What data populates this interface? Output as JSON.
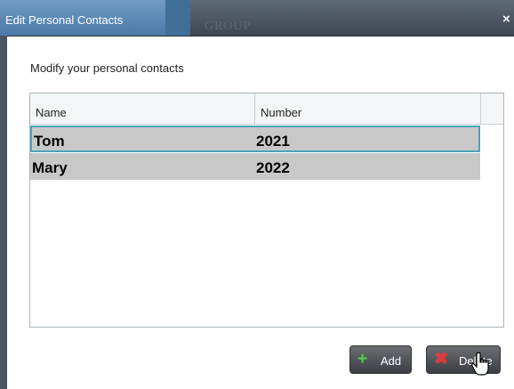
{
  "dialog": {
    "title": "Edit Personal Contacts",
    "background_title": "GROUP",
    "close_label": "×",
    "subtitle": "Modify your personal contacts"
  },
  "table": {
    "columns": [
      "Name",
      "Number"
    ],
    "rows": [
      {
        "name": "Tom",
        "number": "2021",
        "selected": true
      },
      {
        "name": "Mary",
        "number": "2022",
        "selected": false
      }
    ]
  },
  "buttons": {
    "add_label": "Add",
    "delete_label": "Delete"
  },
  "icons": {
    "add": "plus-icon",
    "delete": "x-icon",
    "close": "close-icon",
    "cursor": "hand-pointer-icon"
  },
  "colors": {
    "title_tab": "#5b8ab7",
    "titlebar": "#4a525e",
    "row_bg": "#c8c8c8",
    "selection_border": "#4aa3b6",
    "add_icon": "#4fd34a",
    "delete_icon": "#e03b3b"
  }
}
